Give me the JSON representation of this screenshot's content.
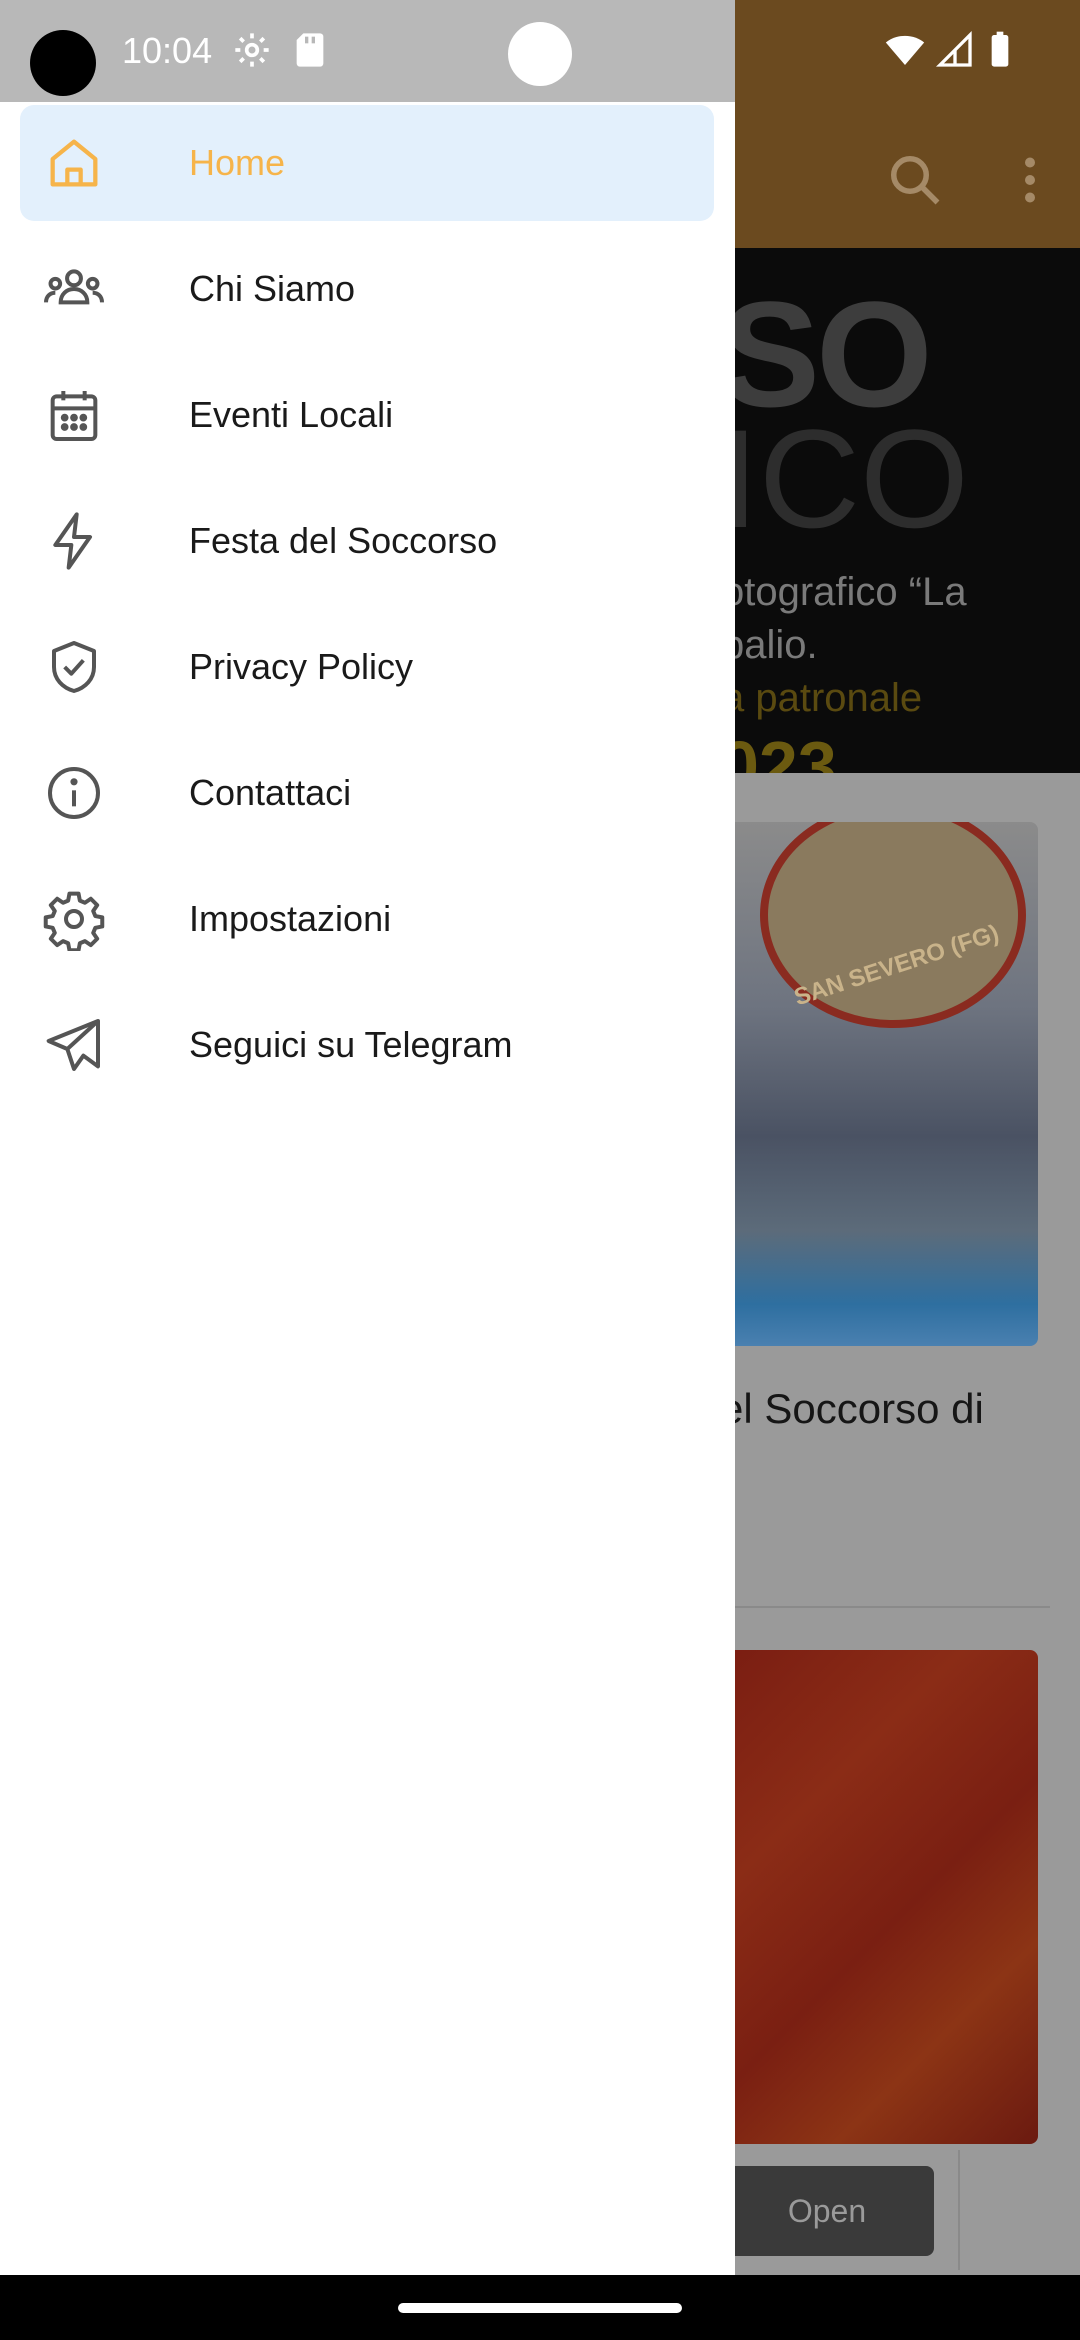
{
  "status_bar": {
    "time": "10:04"
  },
  "drawer": {
    "items": [
      {
        "label": "Home",
        "icon": "home-icon",
        "active": true
      },
      {
        "label": "Chi Siamo",
        "icon": "people-icon",
        "active": false
      },
      {
        "label": "Eventi Locali",
        "icon": "calendar-icon",
        "active": false
      },
      {
        "label": "Festa del Soccorso",
        "icon": "lightning-icon",
        "active": false
      },
      {
        "label": "Privacy Policy",
        "icon": "shield-check-icon",
        "active": false
      },
      {
        "label": "Contattaci",
        "icon": "info-icon",
        "active": false
      },
      {
        "label": "Impostazioni",
        "icon": "gear-icon",
        "active": false
      },
      {
        "label": "Seguici su Telegram",
        "icon": "telegram-icon",
        "active": false
      }
    ]
  },
  "background": {
    "hero_big1": "SO",
    "hero_big2": "ICO",
    "hero_line1": "otografico “La",
    "hero_line2": "palio.",
    "hero_line3": "a patronale",
    "hero_year": "023",
    "badge_text": "SAN SEVERO (FG)",
    "card_title": "el Soccorso di",
    "open_button": "Open"
  },
  "colors": {
    "accent": "#f6b44a",
    "active_bg": "#e3f0fc",
    "toolbar": "#6b4a1f"
  }
}
